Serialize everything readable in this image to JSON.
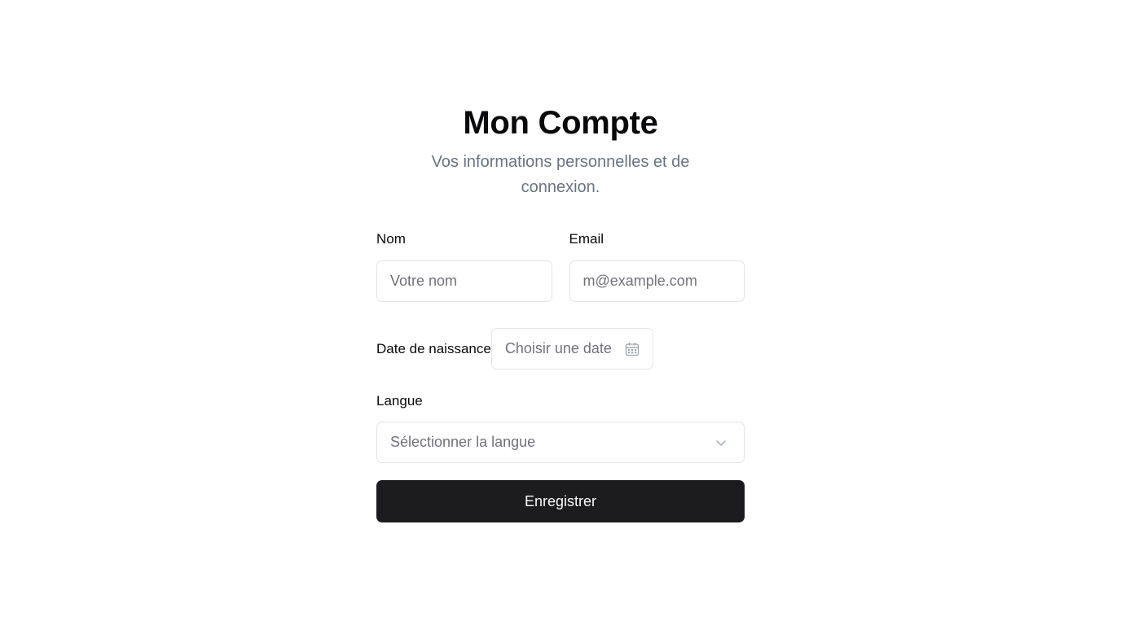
{
  "header": {
    "title": "Mon Compte",
    "subtitle": "Vos informations personnelles et de connexion."
  },
  "form": {
    "name": {
      "label": "Nom",
      "placeholder": "Votre nom",
      "value": ""
    },
    "email": {
      "label": "Email",
      "placeholder": "m@example.com",
      "value": ""
    },
    "birthdate": {
      "label": "Date de naissance",
      "button_text": "Choisir une date",
      "icon": "calendar-icon"
    },
    "language": {
      "label": "Langue",
      "placeholder": "Sélectionner la langue",
      "icon": "chevron-down-icon"
    },
    "submit_label": "Enregistrer"
  },
  "colors": {
    "primary_button": "#1c1c1e",
    "border": "#e4e4e7",
    "muted_text": "#6b7280"
  }
}
